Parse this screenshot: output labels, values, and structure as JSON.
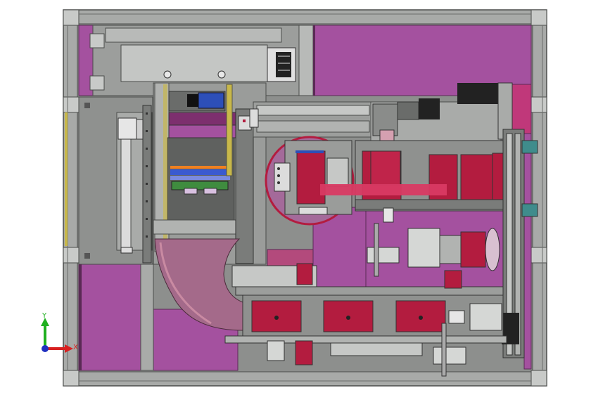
{
  "viewport": {
    "background": "#ffffff"
  },
  "colors": {
    "frame": "#a8aaa8",
    "frame_dark": "#5a5c5a",
    "panel_magenta": "#a4519f",
    "panel_dark_magenta": "#7d2f6e",
    "plate_gray": "#8d8f8d",
    "plate_dark": "#6e706e",
    "part_red": "#b31c3f",
    "part_light_red": "#d93a63",
    "belt_pink": "#c98aa2",
    "motor_blue": "#2d4fb8",
    "accent_yellow": "#c8b84a",
    "accent_green": "#4f8f4f",
    "teal": "#3f8c8c",
    "black": "#222222"
  },
  "triad": {
    "x_label": "X",
    "y_label": "Y",
    "x_color": "#d82020",
    "y_color": "#20b020",
    "origin_color": "#2030c0"
  }
}
